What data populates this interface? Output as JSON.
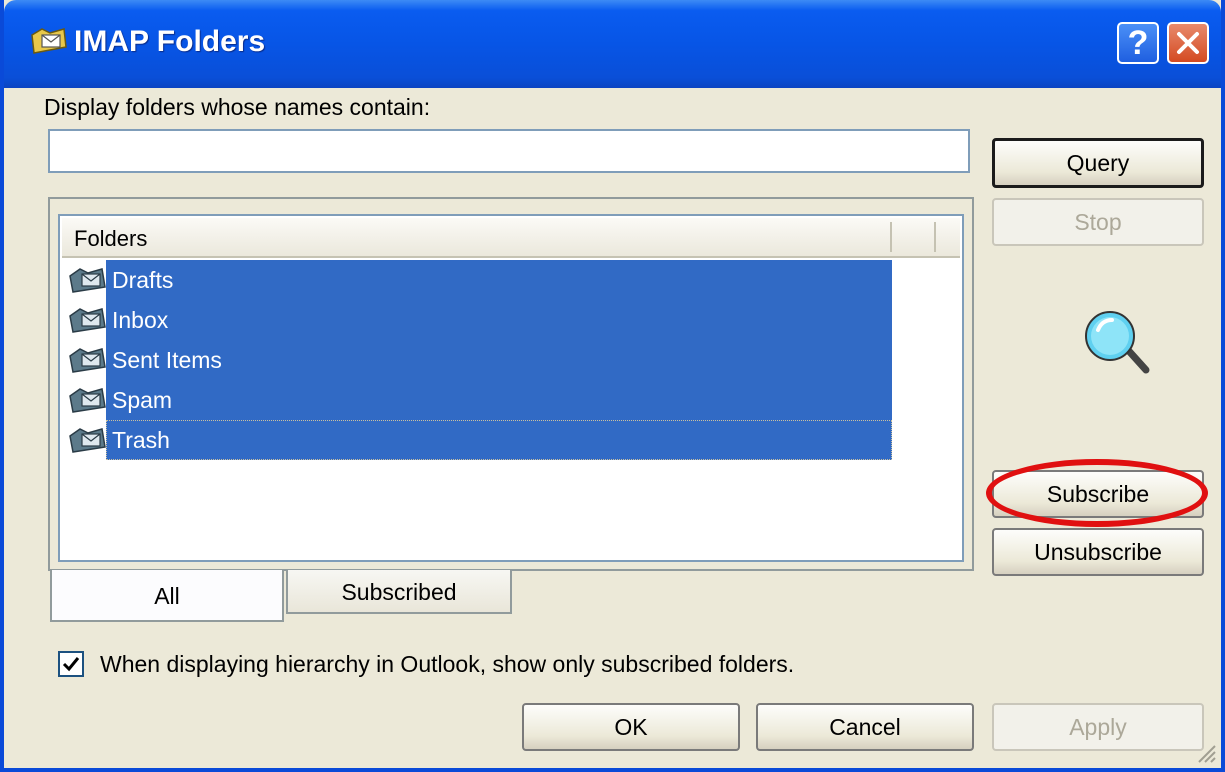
{
  "window": {
    "title": "IMAP Folders",
    "help_button": "?"
  },
  "filter": {
    "label": "Display folders whose names contain:",
    "value": "",
    "placeholder": ""
  },
  "buttons": {
    "query": "Query",
    "stop": "Stop",
    "subscribe": "Subscribe",
    "unsubscribe": "Unsubscribe",
    "ok": "OK",
    "cancel": "Cancel",
    "apply": "Apply"
  },
  "list": {
    "column_header": "Folders",
    "folders": [
      {
        "name": "Drafts",
        "selected": true
      },
      {
        "name": "Inbox",
        "selected": true
      },
      {
        "name": "Sent Items",
        "selected": true
      },
      {
        "name": "Spam",
        "selected": true
      },
      {
        "name": "Trash",
        "selected": true
      }
    ]
  },
  "tabs": [
    {
      "label": "All",
      "active": true
    },
    {
      "label": "Subscribed",
      "active": false
    }
  ],
  "option": {
    "label": "When displaying hierarchy in Outlook, show only subscribed folders.",
    "checked": true
  },
  "colors": {
    "selection": "#316ac5",
    "annotation": "#e01010",
    "titlebar": "#0a5cf0"
  },
  "icons": {
    "title": "folder-envelope-icon",
    "folder": "folder-envelope-icon",
    "search": "magnifier-icon"
  }
}
